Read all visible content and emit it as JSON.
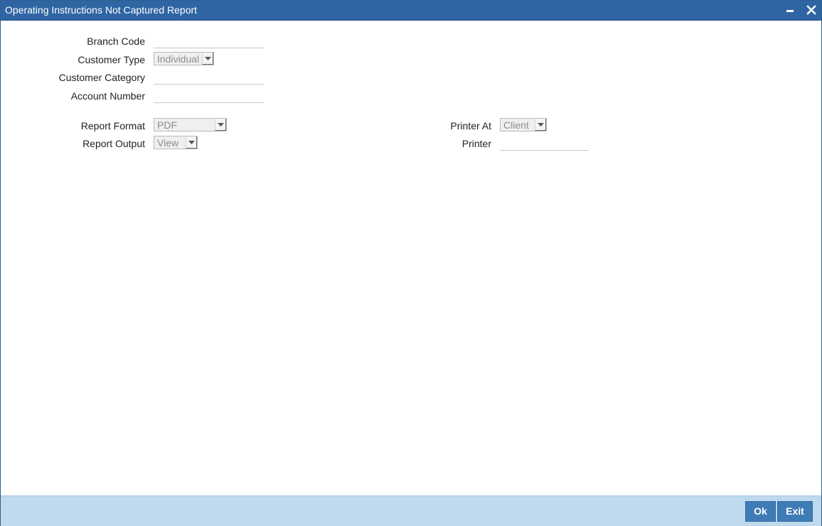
{
  "window": {
    "title": "Operating Instructions Not Captured Report",
    "minimize_icon": "minimize-icon",
    "close_icon": "close-icon"
  },
  "form": {
    "branch_code": {
      "label": "Branch Code",
      "value": ""
    },
    "customer_type": {
      "label": "Customer Type",
      "selected": "Individual"
    },
    "customer_category": {
      "label": "Customer Category",
      "value": ""
    },
    "account_number": {
      "label": "Account Number",
      "value": ""
    },
    "report_format": {
      "label": "Report Format",
      "selected": "PDF"
    },
    "report_output": {
      "label": "Report Output",
      "selected": "View"
    },
    "printer_at": {
      "label": "Printer At",
      "selected": "Client"
    },
    "printer": {
      "label": "Printer",
      "value": ""
    }
  },
  "footer": {
    "ok_label": "Ok",
    "exit_label": "Exit"
  },
  "colors": {
    "titlebar": "#2f65a3",
    "footer": "#bfd9ee",
    "button": "#3f7cb5"
  }
}
